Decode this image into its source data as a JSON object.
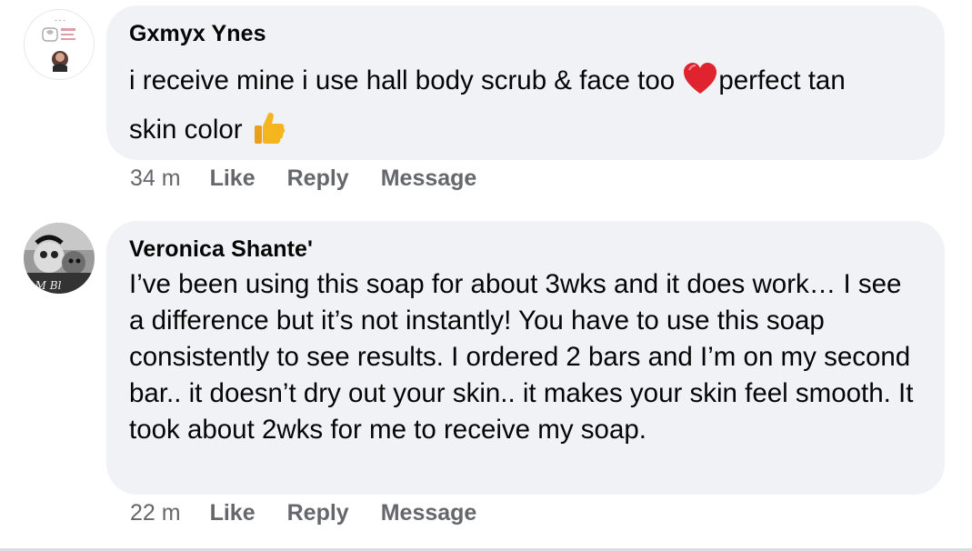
{
  "comments": [
    {
      "author": "Gxmyx Ynes",
      "text_line1": "i receive mine i use hall body scrub & face too ",
      "emoji1": "red-heart",
      "text_line1b": "perfect tan",
      "text_line2": "skin color ",
      "emoji2": "thumbs-up",
      "time": "34 m",
      "like_label": "Like",
      "reply_label": "Reply",
      "message_label": "Message"
    },
    {
      "author": "Veronica Shante'",
      "text": "I’ve been using this soap for about 3wks and it does work… I see a difference but it’s not instantly! You have to use this soap consistently to see results. I ordered 2 bars and I’m on my second bar.. it doesn’t dry out your skin.. it makes your skin feel smooth. It took about 2wks for me to receive my soap.",
      "time": "22 m",
      "like_label": "Like",
      "reply_label": "Reply",
      "message_label": "Message"
    }
  ],
  "colors": {
    "bubble_bg": "#f0f2f5",
    "text": "#050505",
    "meta": "#65676b",
    "heart": "#e0242f",
    "thumb": "#f5b51e"
  }
}
